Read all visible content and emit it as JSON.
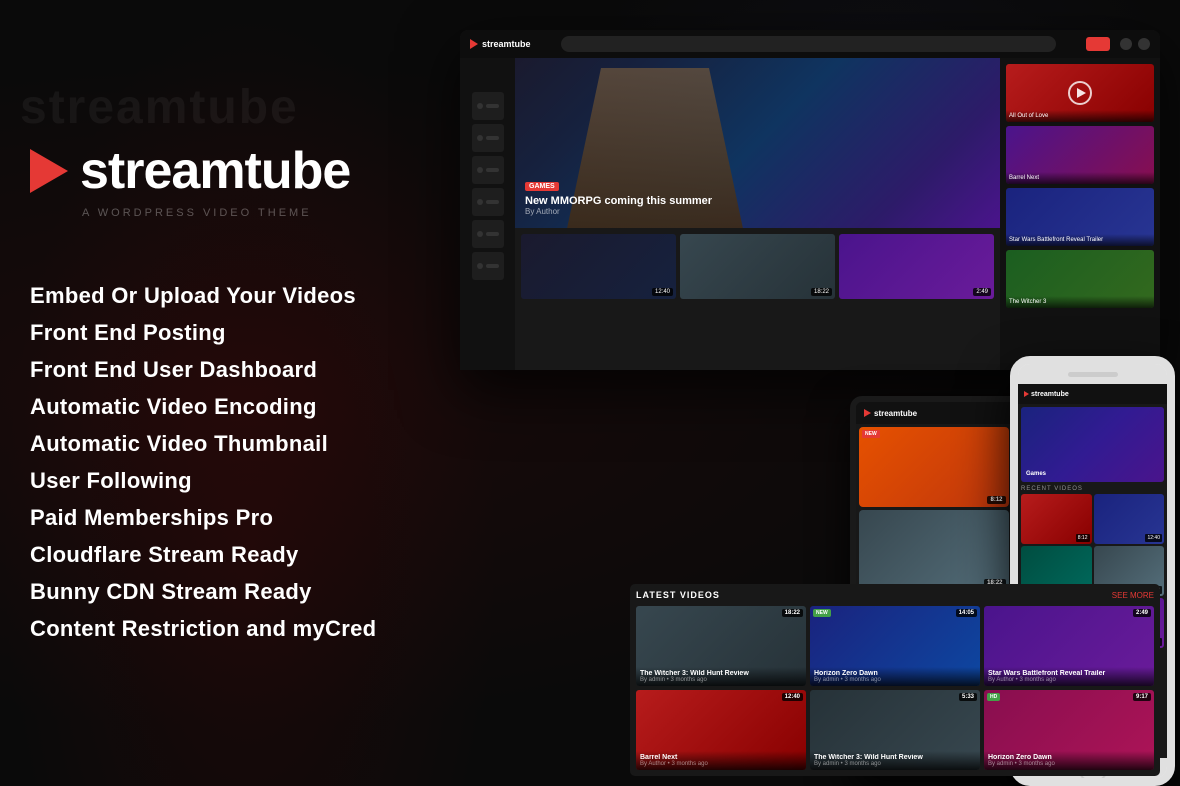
{
  "brand": {
    "name": "streamtube",
    "tagline": "A WORDPRESS VIDEO THEME",
    "logo_text": "streamtube"
  },
  "features": [
    "Embed Or Upload Your Videos",
    "Front End Posting",
    "Front End User Dashboard",
    "Automatic Video Encoding",
    "Automatic Video Thumbnail",
    "User Following",
    "Paid Memberships Pro",
    "Cloudflare Stream Ready",
    "Bunny CDN Stream Ready",
    "Content Restriction and myCred"
  ],
  "colors": {
    "accent": "#e53935",
    "background": "#0a0a0a",
    "text": "#ffffff"
  },
  "demo": {
    "hero_title": "New MMORPG coming this summer",
    "hero_author": "By Author",
    "videos": [
      {
        "title": "Barrel Next",
        "duration": "12:40",
        "meta": "By Author • 3 months ago"
      },
      {
        "title": "Star Wars Battlefront Reveal Trailer",
        "duration": "2:49",
        "meta": "By Author • 3 months ago"
      },
      {
        "title": "The Witcher 3: Wild Hunt Review",
        "duration": "18:22",
        "meta": "By admin • 3 months ago"
      },
      {
        "title": "Horizon Zero Dawn",
        "duration": "14:05",
        "meta": "By admin • 3 months ago"
      }
    ]
  }
}
